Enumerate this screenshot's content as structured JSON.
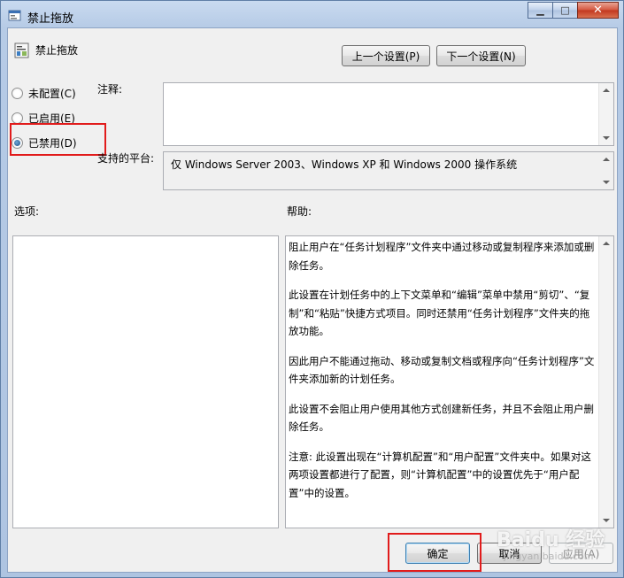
{
  "window": {
    "title": "禁止拖放",
    "minimize_glyph": "▁",
    "maximize_glyph": "□",
    "close_glyph": "✕"
  },
  "header": {
    "policy_name": "禁止拖放",
    "prev_button": "上一个设置(P)",
    "next_button": "下一个设置(N)"
  },
  "state": {
    "options": [
      {
        "label": "未配置(C)",
        "checked": false
      },
      {
        "label": "已启用(E)",
        "checked": false
      },
      {
        "label": "已禁用(D)",
        "checked": true
      }
    ]
  },
  "comment": {
    "label": "注释:",
    "value": ""
  },
  "platform": {
    "label": "支持的平台:",
    "value": "仅 Windows Server 2003、Windows XP 和 Windows 2000 操作系统"
  },
  "options_panel": {
    "label": "选项:"
  },
  "help": {
    "label": "帮助:",
    "paragraphs": [
      "阻止用户在“任务计划程序”文件夹中通过移动或复制程序来添加或删除任务。",
      "此设置在计划任务中的上下文菜单和“编辑”菜单中禁用“剪切”、“复制”和“粘贴”快捷方式项目。同时还禁用“任务计划程序”文件夹的拖放功能。",
      "因此用户不能通过拖动、移动或复制文档或程序向“任务计划程序”文件夹添加新的计划任务。",
      "此设置不会阻止用户使用其他方式创建新任务，并且不会阻止用户删除任务。",
      "注意: 此设置出现在“计算机配置”和“用户配置”文件夹中。如果对这两项设置都进行了配置，则“计算机配置”中的设置优先于“用户配置”中的设置。"
    ]
  },
  "footer": {
    "ok_button": "确定",
    "cancel_button": "取消",
    "apply_button": "应用(A)"
  },
  "watermark": {
    "text": "Baidu 经验",
    "subtext": "jingyan.baidu.com"
  },
  "colors": {
    "highlight": "#e11b1b",
    "radio_checked": "#1c4e86"
  }
}
